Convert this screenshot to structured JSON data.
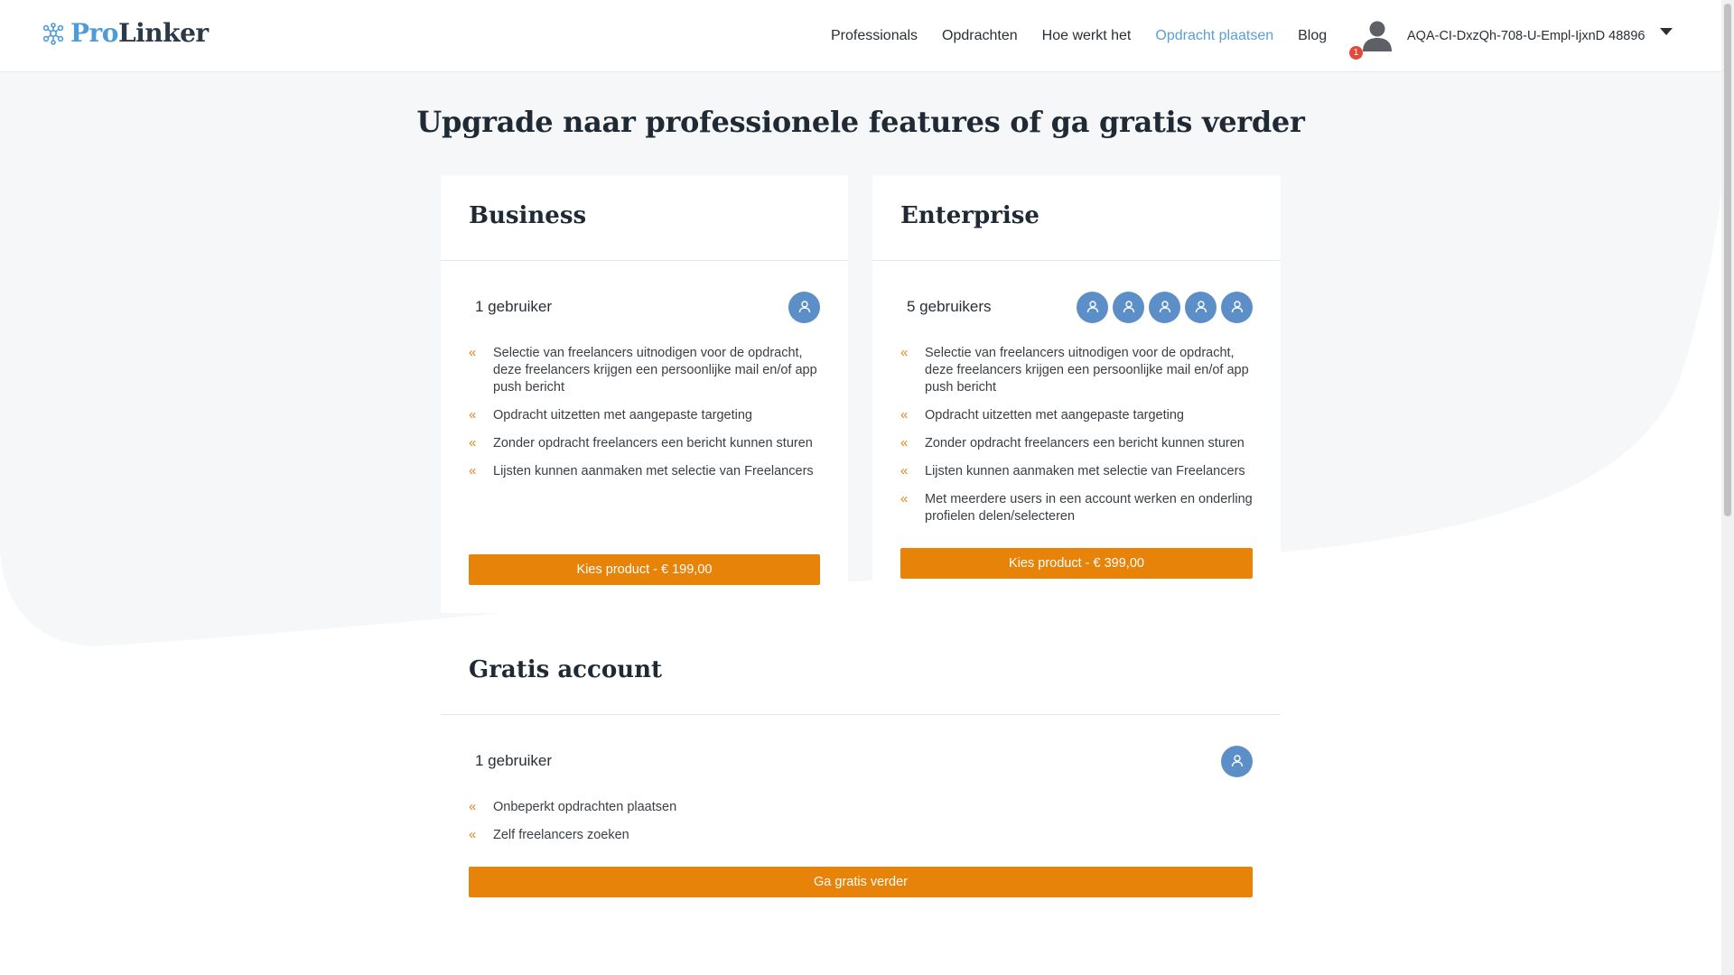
{
  "colors": {
    "accent": "#e8830a",
    "link_active": "#5b9fd4",
    "user_icon": "#5c8fc7",
    "badge": "#e24a3b"
  },
  "header": {
    "logo_pro": "Pro",
    "logo_linker": "Linker",
    "nav": [
      "Professionals",
      "Opdrachten",
      "Hoe werkt het",
      "Opdracht plaatsen",
      "Blog"
    ],
    "active_nav": "Opdracht plaatsen",
    "notification_count": "1",
    "username": "AQA-CI-DxzQh-708-U-Empl-IjxnD 48896",
    "icons": {
      "user": "user-avatar-icon",
      "menu": "caret-down-icon",
      "logo": "network-nodes-icon"
    }
  },
  "page": {
    "title": "Upgrade naar professionele features of ga gratis verder"
  },
  "plans": {
    "business": {
      "name": "Business",
      "users_label": "1 gebruiker",
      "user_count": 1,
      "features": [
        "Selectie van freelancers uitnodigen voor de opdracht, deze freelancers krijgen een persoonlijke mail en/of app push bericht",
        "Opdracht uitzetten met aangepaste targeting",
        "Zonder opdracht freelancers een bericht kunnen sturen",
        "Lijsten kunnen aanmaken met selectie van Freelancers"
      ],
      "cta": "Kies product - € 199,00"
    },
    "enterprise": {
      "name": "Enterprise",
      "users_label": "5 gebruikers",
      "user_count": 5,
      "features": [
        "Selectie van freelancers uitnodigen voor de opdracht, deze freelancers krijgen een persoonlijke mail en/of app push bericht",
        "Opdracht uitzetten met aangepaste targeting",
        "Zonder opdracht freelancers een bericht kunnen sturen",
        "Lijsten kunnen aanmaken met selectie van Freelancers",
        "Met meerdere users in een account werken en onderling profielen delen/selecteren"
      ],
      "cta": "Kies product - € 399,00"
    },
    "free": {
      "name": "Gratis account",
      "users_label": "1 gebruiker",
      "user_count": 1,
      "features": [
        "Onbeperkt opdrachten plaatsen",
        "Zelf freelancers zoeken"
      ],
      "cta": "Ga gratis verder"
    }
  },
  "feature_bullet": "«"
}
